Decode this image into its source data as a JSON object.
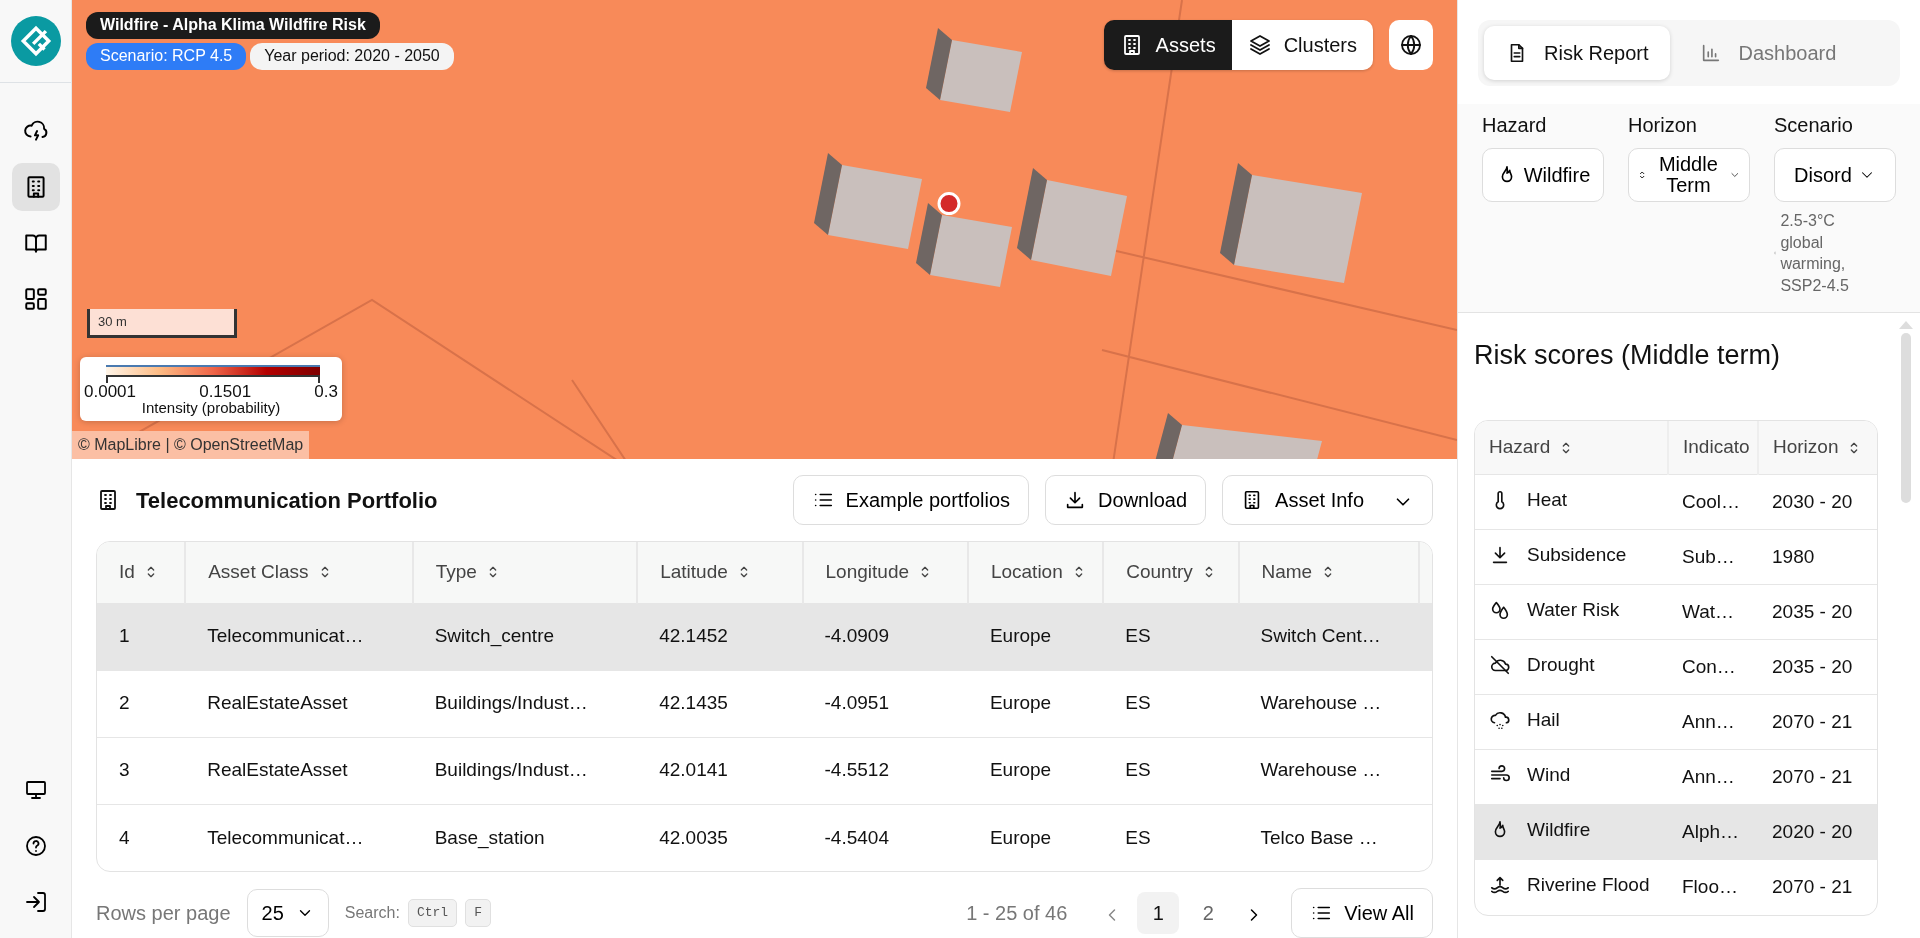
{
  "sidebar": {
    "items": [
      {
        "selected": false
      },
      {
        "selected": true
      },
      {
        "selected": false
      },
      {
        "selected": false
      }
    ],
    "bottom_items": [
      {
        "selected": false
      },
      {
        "selected": false
      },
      {
        "selected": false
      }
    ]
  },
  "map": {
    "layer_title": "Wildfire - Alpha Klima Wildfire Risk",
    "scenario_badge": "Scenario: RCP 4.5",
    "period_badge": "Year period: 2020 - 2050",
    "view_toggle": [
      {
        "label": "Assets",
        "selected": true
      },
      {
        "label": "Clusters",
        "selected": false
      }
    ],
    "scale": "30 m",
    "legend": {
      "ticks": [
        "0.0001",
        "0.1501",
        "0.3"
      ],
      "title": "Intensity (probability)"
    },
    "attribution": "© MapLibre | © OpenStreetMap"
  },
  "portfolio": {
    "title": "Telecommunication Portfolio",
    "buttons": [
      "Example portfolios",
      "Download",
      "Asset Info"
    ],
    "columns": [
      "Id",
      "Asset Class",
      "Type",
      "Latitude",
      "Longitude",
      "Location",
      "Country",
      "Name"
    ],
    "rows": [
      {
        "selected": true,
        "cells": [
          "1",
          "Telecommunicat…",
          "Switch_centre",
          "42.1452",
          "-4.0909",
          "Europe",
          "ES",
          "Switch Cent…"
        ]
      },
      {
        "selected": false,
        "cells": [
          "2",
          "RealEstateAsset",
          "Buildings/Indust…",
          "42.1435",
          "-4.0951",
          "Europe",
          "ES",
          "Warehouse …"
        ]
      },
      {
        "selected": false,
        "cells": [
          "3",
          "RealEstateAsset",
          "Buildings/Indust…",
          "42.0141",
          "-4.5512",
          "Europe",
          "ES",
          "Warehouse …"
        ]
      },
      {
        "selected": false,
        "cells": [
          "4",
          "Telecommunicat…",
          "Base_station",
          "42.0035",
          "-4.5404",
          "Europe",
          "ES",
          "Telco Base …"
        ]
      }
    ],
    "footer": {
      "rows_label": "Rows per page",
      "rows_value": "25",
      "search_label": "Search:",
      "keys": [
        "Ctrl",
        "F"
      ],
      "range": "1 - 25 of 46",
      "pages": [
        {
          "label": "1",
          "selected": true
        },
        {
          "label": "2",
          "selected": false
        }
      ],
      "view_all": "View All"
    }
  },
  "right_panel": {
    "tabs": [
      {
        "label": "Risk Report",
        "selected": true
      },
      {
        "label": "Dashboard",
        "selected": false
      }
    ],
    "filters": [
      {
        "label": "Hazard",
        "value": "Wildfire"
      },
      {
        "label": "Horizon",
        "value": "Middle Term"
      },
      {
        "label": "Scenario",
        "value": "Disord"
      }
    ],
    "scenario_note": "2.5-3°C global warming, SSP2-4.5",
    "title": "Risk scores (Middle term)",
    "columns": [
      "Hazard",
      "Indicato",
      "Horizon"
    ],
    "rows": [
      {
        "kind": "heat",
        "hazard": "Heat",
        "indicator": "Cool…",
        "horizon": "2030 - 20",
        "selected": false
      },
      {
        "kind": "subsidence",
        "hazard": "Subsidence",
        "indicator": "Sub…",
        "horizon": "1980",
        "selected": false
      },
      {
        "kind": "water",
        "hazard": "Water Risk",
        "indicator": "Wat…",
        "horizon": "2035 - 20",
        "selected": false
      },
      {
        "kind": "drought",
        "hazard": "Drought",
        "indicator": "Con…",
        "horizon": "2035 - 20",
        "selected": false
      },
      {
        "kind": "hail",
        "hazard": "Hail",
        "indicator": "Ann…",
        "horizon": "2070 - 21",
        "selected": false
      },
      {
        "kind": "wind",
        "hazard": "Wind",
        "indicator": "Ann…",
        "horizon": "2070 - 21",
        "selected": false
      },
      {
        "kind": "wildfire",
        "hazard": "Wildfire",
        "indicator": "Alph…",
        "horizon": "2020 - 20",
        "selected": true
      },
      {
        "kind": "flood",
        "hazard": "Riverine Flood",
        "indicator": "Floo…",
        "horizon": "2070 - 21",
        "selected": false
      }
    ]
  }
}
